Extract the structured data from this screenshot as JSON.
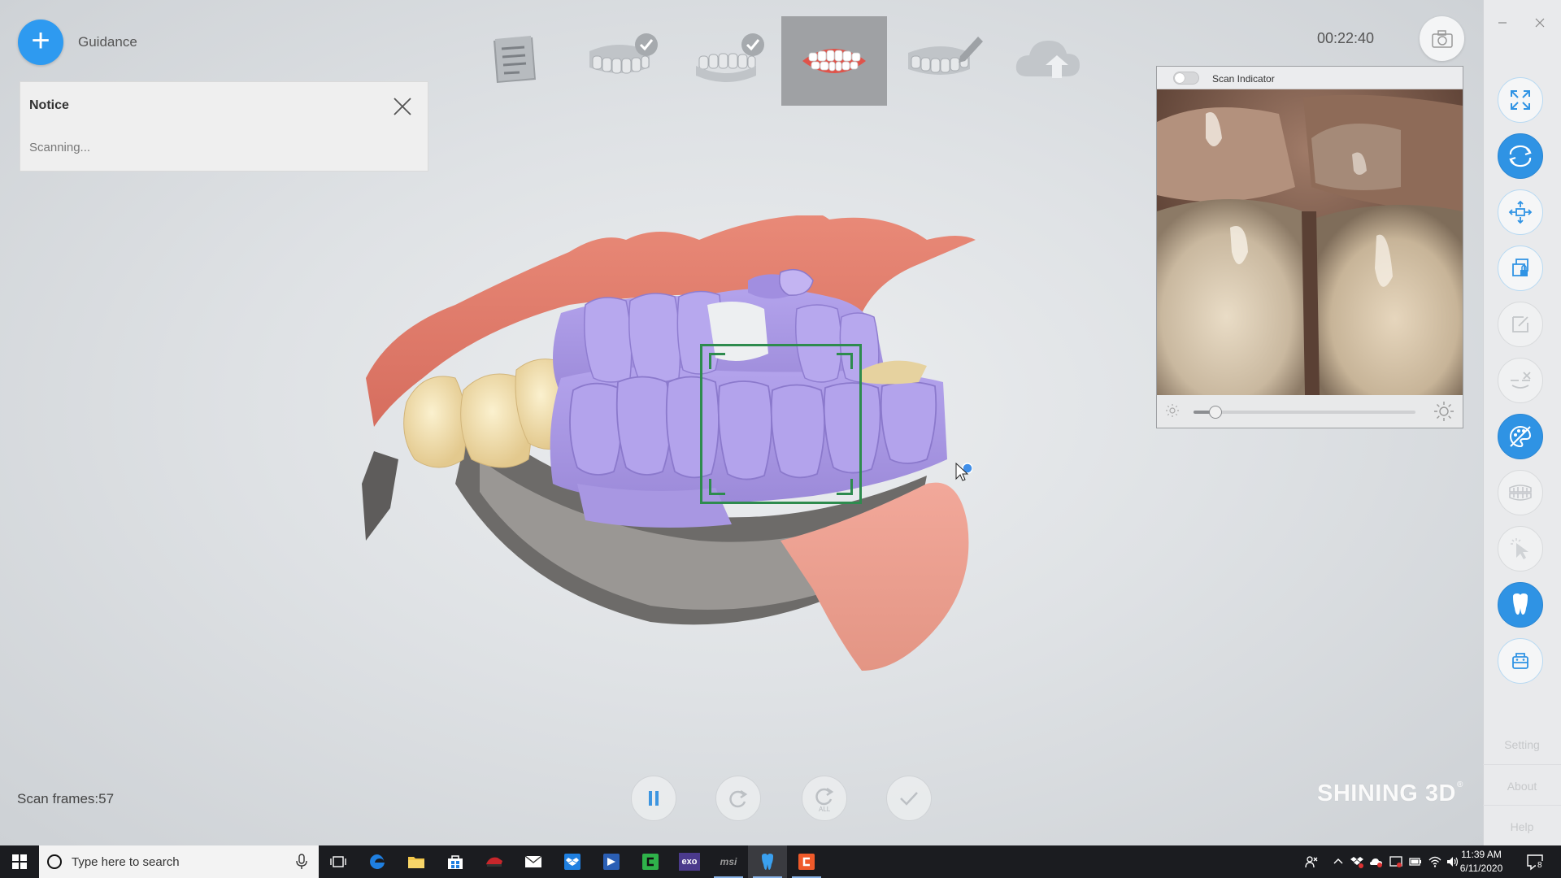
{
  "guidance": {
    "label": "Guidance",
    "icon": "plus-icon"
  },
  "notice": {
    "title": "Notice",
    "message": "Scanning...",
    "close_icon": "close-icon"
  },
  "steps": [
    {
      "name": "order-info",
      "icon": "document-icon",
      "done": false,
      "active": false
    },
    {
      "name": "upper-jaw",
      "icon": "upper-jaw-icon",
      "done": true,
      "active": false
    },
    {
      "name": "lower-jaw",
      "icon": "lower-jaw-icon",
      "done": true,
      "active": false
    },
    {
      "name": "bite",
      "icon": "bite-icon",
      "done": false,
      "active": true
    },
    {
      "name": "edit",
      "icon": "edit-jaw-icon",
      "done": false,
      "active": false
    },
    {
      "name": "upload",
      "icon": "cloud-upload-icon",
      "done": false,
      "active": false
    }
  ],
  "timer": "00:22:40",
  "camera_icon": "camera-icon",
  "scan_indicator": {
    "title": "Scan Indicator",
    "toggle_on": false,
    "brightness": 0.1
  },
  "scan_frames": "Scan frames:57",
  "controls": [
    {
      "name": "pause-button",
      "icon": "pause-icon",
      "enabled": true
    },
    {
      "name": "redo-button",
      "icon": "redo-icon",
      "enabled": false
    },
    {
      "name": "redo-all-button",
      "icon": "redo-all-icon",
      "label": "ALL",
      "enabled": false
    },
    {
      "name": "confirm-button",
      "icon": "check-icon",
      "enabled": false
    }
  ],
  "brand": "SHINING 3D",
  "brand_mark": "®",
  "right_tools": [
    {
      "name": "fit-view-button",
      "icon": "expand-icon",
      "style": "outline"
    },
    {
      "name": "rotate-view-button",
      "icon": "rotate-icon",
      "style": "filled"
    },
    {
      "name": "move-view-button",
      "icon": "move-icon",
      "style": "outline"
    },
    {
      "name": "lock-region-button",
      "icon": "lock-region-icon",
      "style": "outline"
    },
    {
      "name": "edit-tool-button",
      "icon": "pencil-icon",
      "style": "dim"
    },
    {
      "name": "trim-tool-button",
      "icon": "trim-icon",
      "style": "dim"
    },
    {
      "name": "texture-button",
      "icon": "palette-icon",
      "style": "filled"
    },
    {
      "name": "occlusion-button",
      "icon": "teeth-icon",
      "style": "dim"
    },
    {
      "name": "select-tool-button",
      "icon": "cursor-icon",
      "style": "dim"
    },
    {
      "name": "tooth-button",
      "icon": "tooth-icon",
      "style": "filled"
    },
    {
      "name": "scanner-button",
      "icon": "scanner-icon",
      "style": "outline"
    }
  ],
  "right_links": {
    "setting": "Setting",
    "about": "About",
    "help": "Help"
  },
  "taskbar": {
    "search_placeholder": "Type here to search",
    "apps": [
      {
        "name": "task-view",
        "icon": "task-view-icon"
      },
      {
        "name": "edge",
        "icon": "edge-icon"
      },
      {
        "name": "file-explorer",
        "icon": "folder-icon"
      },
      {
        "name": "store",
        "icon": "store-icon"
      },
      {
        "name": "app-red",
        "icon": "app-icon"
      },
      {
        "name": "mail",
        "icon": "mail-icon"
      },
      {
        "name": "dropbox",
        "icon": "dropbox-icon"
      },
      {
        "name": "app-blue",
        "icon": "app-icon"
      },
      {
        "name": "app-green",
        "icon": "app-icon"
      },
      {
        "name": "exo",
        "icon": "exo-icon",
        "label": "exo"
      },
      {
        "name": "msi",
        "icon": "msi-icon",
        "label": "msi"
      },
      {
        "name": "dental-app",
        "icon": "tooth-icon"
      },
      {
        "name": "app-orange",
        "icon": "app-icon"
      }
    ],
    "time": "11:39 AM",
    "date": "6/11/2020",
    "notifications": "8"
  }
}
